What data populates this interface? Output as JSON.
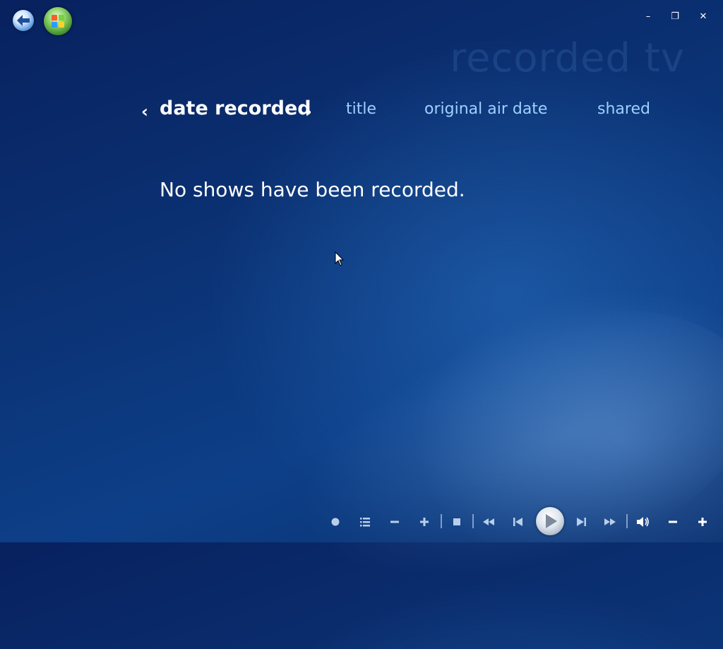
{
  "page_title": "recorded tv",
  "sort_tabs": {
    "active": "date recorded",
    "tabs": [
      "title",
      "original air date",
      "shared"
    ]
  },
  "message": "No shows have been recorded.",
  "window_controls": {
    "minimize": "–",
    "restore": "❐",
    "close": "✕"
  },
  "colors": {
    "accent": "#9fd0ff",
    "text": "#ffffff",
    "background": "#0b3274"
  },
  "icons": {
    "back": "back-arrow-icon",
    "start": "windows-start-orb-icon",
    "transport": [
      "record-icon",
      "guide-icon",
      "channel-down-icon",
      "channel-up-icon",
      "stop-icon",
      "rewind-icon",
      "skip-back-icon",
      "play-icon",
      "skip-forward-icon",
      "fast-forward-icon",
      "mute-icon",
      "volume-down-icon",
      "volume-up-icon"
    ]
  }
}
